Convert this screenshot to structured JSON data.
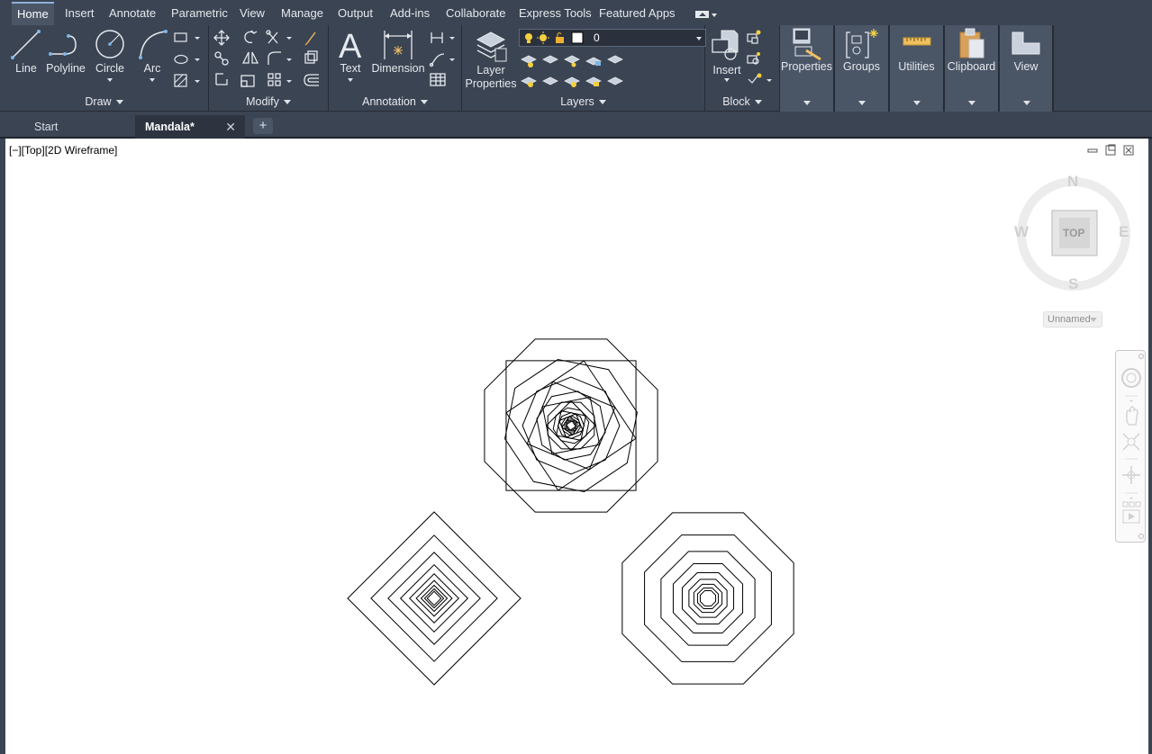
{
  "menu": {
    "tabs": [
      "Home",
      "Insert",
      "Annotate",
      "Parametric",
      "View",
      "Manage",
      "Output",
      "Add-ins",
      "Collaborate",
      "Express Tools",
      "Featured Apps"
    ],
    "active": "Home"
  },
  "ribbon": {
    "draw": {
      "title": "Draw",
      "line": "Line",
      "polyline": "Polyline",
      "circle": "Circle",
      "arc": "Arc"
    },
    "modify": {
      "title": "Modify"
    },
    "annotation": {
      "title": "Annotation",
      "text": "Text",
      "dimension": "Dimension"
    },
    "layers": {
      "title": "Layers",
      "layer_properties_1": "Layer",
      "layer_properties_2": "Properties",
      "current_layer": "0"
    },
    "block": {
      "title": "Block",
      "insert": "Insert"
    },
    "properties": "Properties",
    "groups": "Groups",
    "utilities": "Utilities",
    "clipboard": "Clipboard",
    "view": "View"
  },
  "file_tabs": {
    "start": "Start",
    "active": "Mandala*"
  },
  "viewport": {
    "label": "[−][Top][2D Wireframe]",
    "viewcube": {
      "n": "N",
      "s": "S",
      "e": "E",
      "w": "W",
      "face": "TOP"
    },
    "ucs": "Unnamed"
  }
}
